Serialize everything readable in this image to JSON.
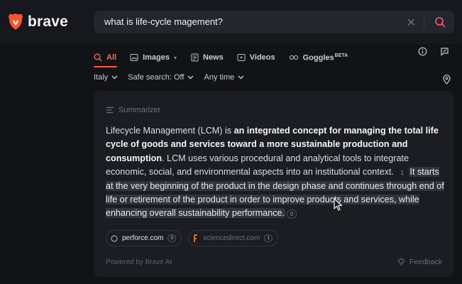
{
  "brand": {
    "name": "brave",
    "accent": "#ff5b3d"
  },
  "search": {
    "query": "what is life-cycle magement?"
  },
  "tabs": [
    {
      "label": "All",
      "icon": "search-icon",
      "active": true
    },
    {
      "label": "Images",
      "icon": "image-icon",
      "has_menu": true
    },
    {
      "label": "News",
      "icon": "news-icon"
    },
    {
      "label": "Videos",
      "icon": "video-icon"
    },
    {
      "label": "Goggles",
      "sup": "BETA",
      "icon": "goggles-icon"
    }
  ],
  "filters": {
    "region": "Italy",
    "safe_search": "Safe search: Off",
    "time": "Any time"
  },
  "summarizer": {
    "title": "Summarizer",
    "p1_plain_a": "Lifecycle Management (LCM) is ",
    "p1_bold_a": "an integrated concept for managing the total life cycle of goods and services toward a more sustainable production and consumption",
    "p1_plain_b": ". LCM uses various procedural and analytical tools to integrate economic, social, and environmental aspects into an institutional context.",
    "cite_1": "1",
    "p1_highlight": "It starts at the very beginning of the product in the design phase and continues through end of life or retirement of the product in order to improve products and services, while enhancing overall sustainability performance.",
    "cite_2": "0",
    "sources": [
      {
        "name": "perforce.com",
        "num": "0"
      },
      {
        "name": "sciencedirect.com",
        "num": "1"
      }
    ],
    "powered_by": "Powered by Brave AI",
    "feedback": "Feedback"
  }
}
